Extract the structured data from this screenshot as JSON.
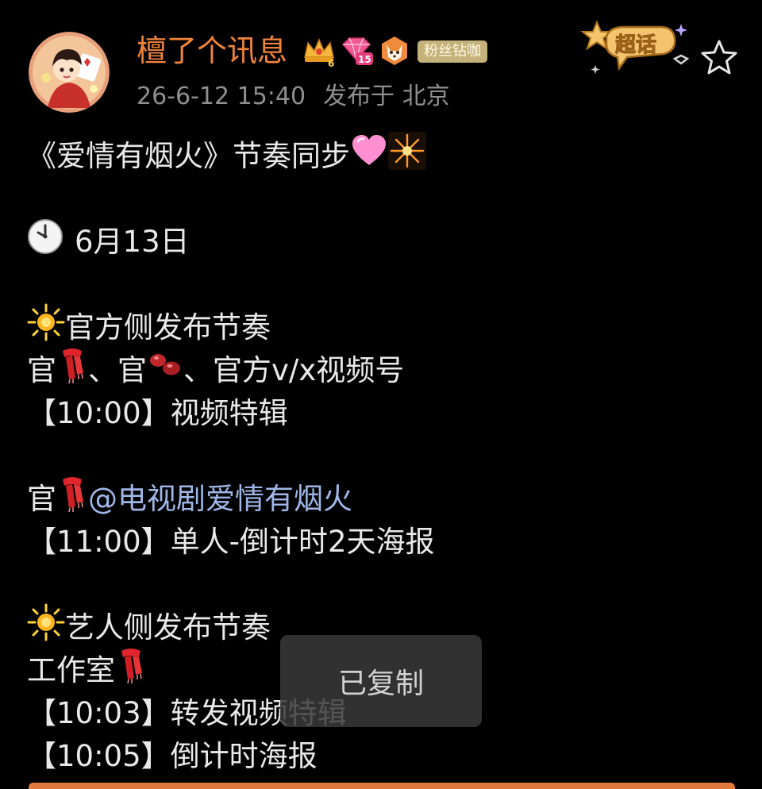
{
  "user": {
    "name": "檀了个讯息",
    "fan_badge": "粉丝钻咖",
    "level_crown": "6",
    "level_gem": "15",
    "timestamp": "26-6-12 15:40",
    "location": "发布于 北京"
  },
  "supertopic": {
    "label": "超话"
  },
  "post": {
    "title": "《爱情有烟火》节奏同步",
    "date": "6月13日",
    "official_heading": "官方侧发布节奏",
    "official_channels_a": "官",
    "official_channels_b": "、官",
    "official_channels_c": "、官方v/x视频号",
    "item1": "【10:00】视频特辑",
    "official2_prefix": "官",
    "mention": "@电视剧爱情有烟火",
    "item2": "【11:00】单人-倒计时2天海报",
    "artist_heading": "艺人侧发布节奏",
    "studio": "工作室",
    "item3": "【10:03】转发视频特辑",
    "item4": "【10:05】倒计时海报"
  },
  "toast": {
    "text": "已复制"
  },
  "colors": {
    "username": "#f0843c",
    "mention": "#9fb7e8",
    "fan_badge": "#c4b27a",
    "meta": "#8f8f8f"
  },
  "icons": {
    "heart": "pink-heart-icon",
    "firework": "firework-icon",
    "clock": "clock-icon",
    "star": "glowing-star-icon",
    "scarf": "red-scarf-icon",
    "beans": "beans-icon"
  }
}
